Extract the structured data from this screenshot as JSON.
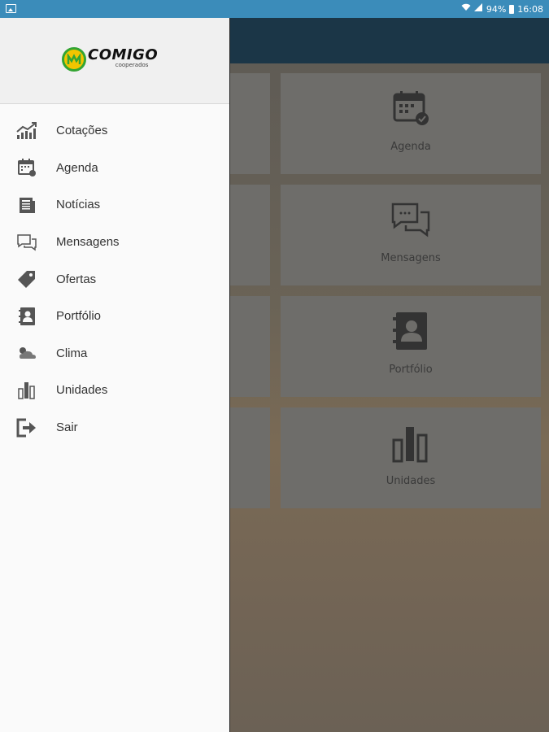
{
  "status_bar": {
    "battery": "94%",
    "time": "16:08"
  },
  "logo": {
    "name": "COMIGO",
    "subtitle": "cooperados"
  },
  "menu": [
    {
      "label": "Cotações",
      "icon": "chart-line-icon"
    },
    {
      "label": "Agenda",
      "icon": "calendar-icon"
    },
    {
      "label": "Notícias",
      "icon": "newspaper-icon"
    },
    {
      "label": "Mensagens",
      "icon": "chat-bubbles-icon"
    },
    {
      "label": "Ofertas",
      "icon": "tag-icon"
    },
    {
      "label": "Portfólio",
      "icon": "contact-book-icon"
    },
    {
      "label": "Clima",
      "icon": "cloud-sun-icon"
    },
    {
      "label": "Unidades",
      "icon": "bar-chart-icon"
    },
    {
      "label": "Sair",
      "icon": "logout-icon"
    }
  ],
  "tiles": [
    {
      "label": "Agenda",
      "icon": "calendar-icon"
    },
    {
      "label": "Mensagens",
      "icon": "chat-bubbles-icon"
    },
    {
      "label": "Portfólio",
      "icon": "contact-book-icon"
    },
    {
      "label": "Unidades",
      "icon": "bar-chart-icon"
    }
  ],
  "colors": {
    "status_bar": "#3b8cba",
    "app_bar": "#1b3647",
    "drawer": "#fafafa",
    "logo_green": "#33a532",
    "logo_yellow": "#f2c500"
  }
}
